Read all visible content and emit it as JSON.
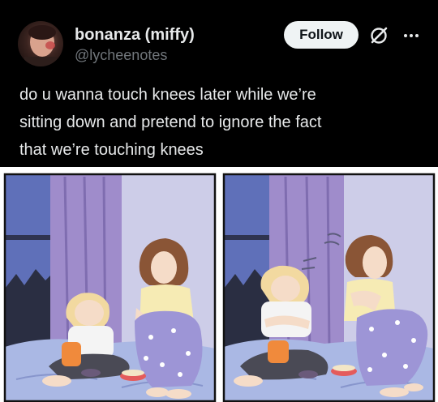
{
  "author": {
    "display_name": "bonanza (miffy)",
    "handle": "@lycheenotes"
  },
  "actions": {
    "follow_label": "Follow",
    "grok_icon": "grok-icon",
    "more_icon": "more-icon"
  },
  "tweet": {
    "lines": [
      "do u wanna touch knees later while we’re",
      "sitting down and pretend to ignore the fact",
      "that we’re touching knees"
    ]
  },
  "colors": {
    "background": "#000000",
    "text": "#e7e9ea",
    "muted": "#71767b",
    "follow_bg": "#eff3f4",
    "curtain": "#9f8ccb",
    "window": "#5f70b9",
    "floor": "#aab8e4",
    "pajamas": "#9d95d6"
  }
}
